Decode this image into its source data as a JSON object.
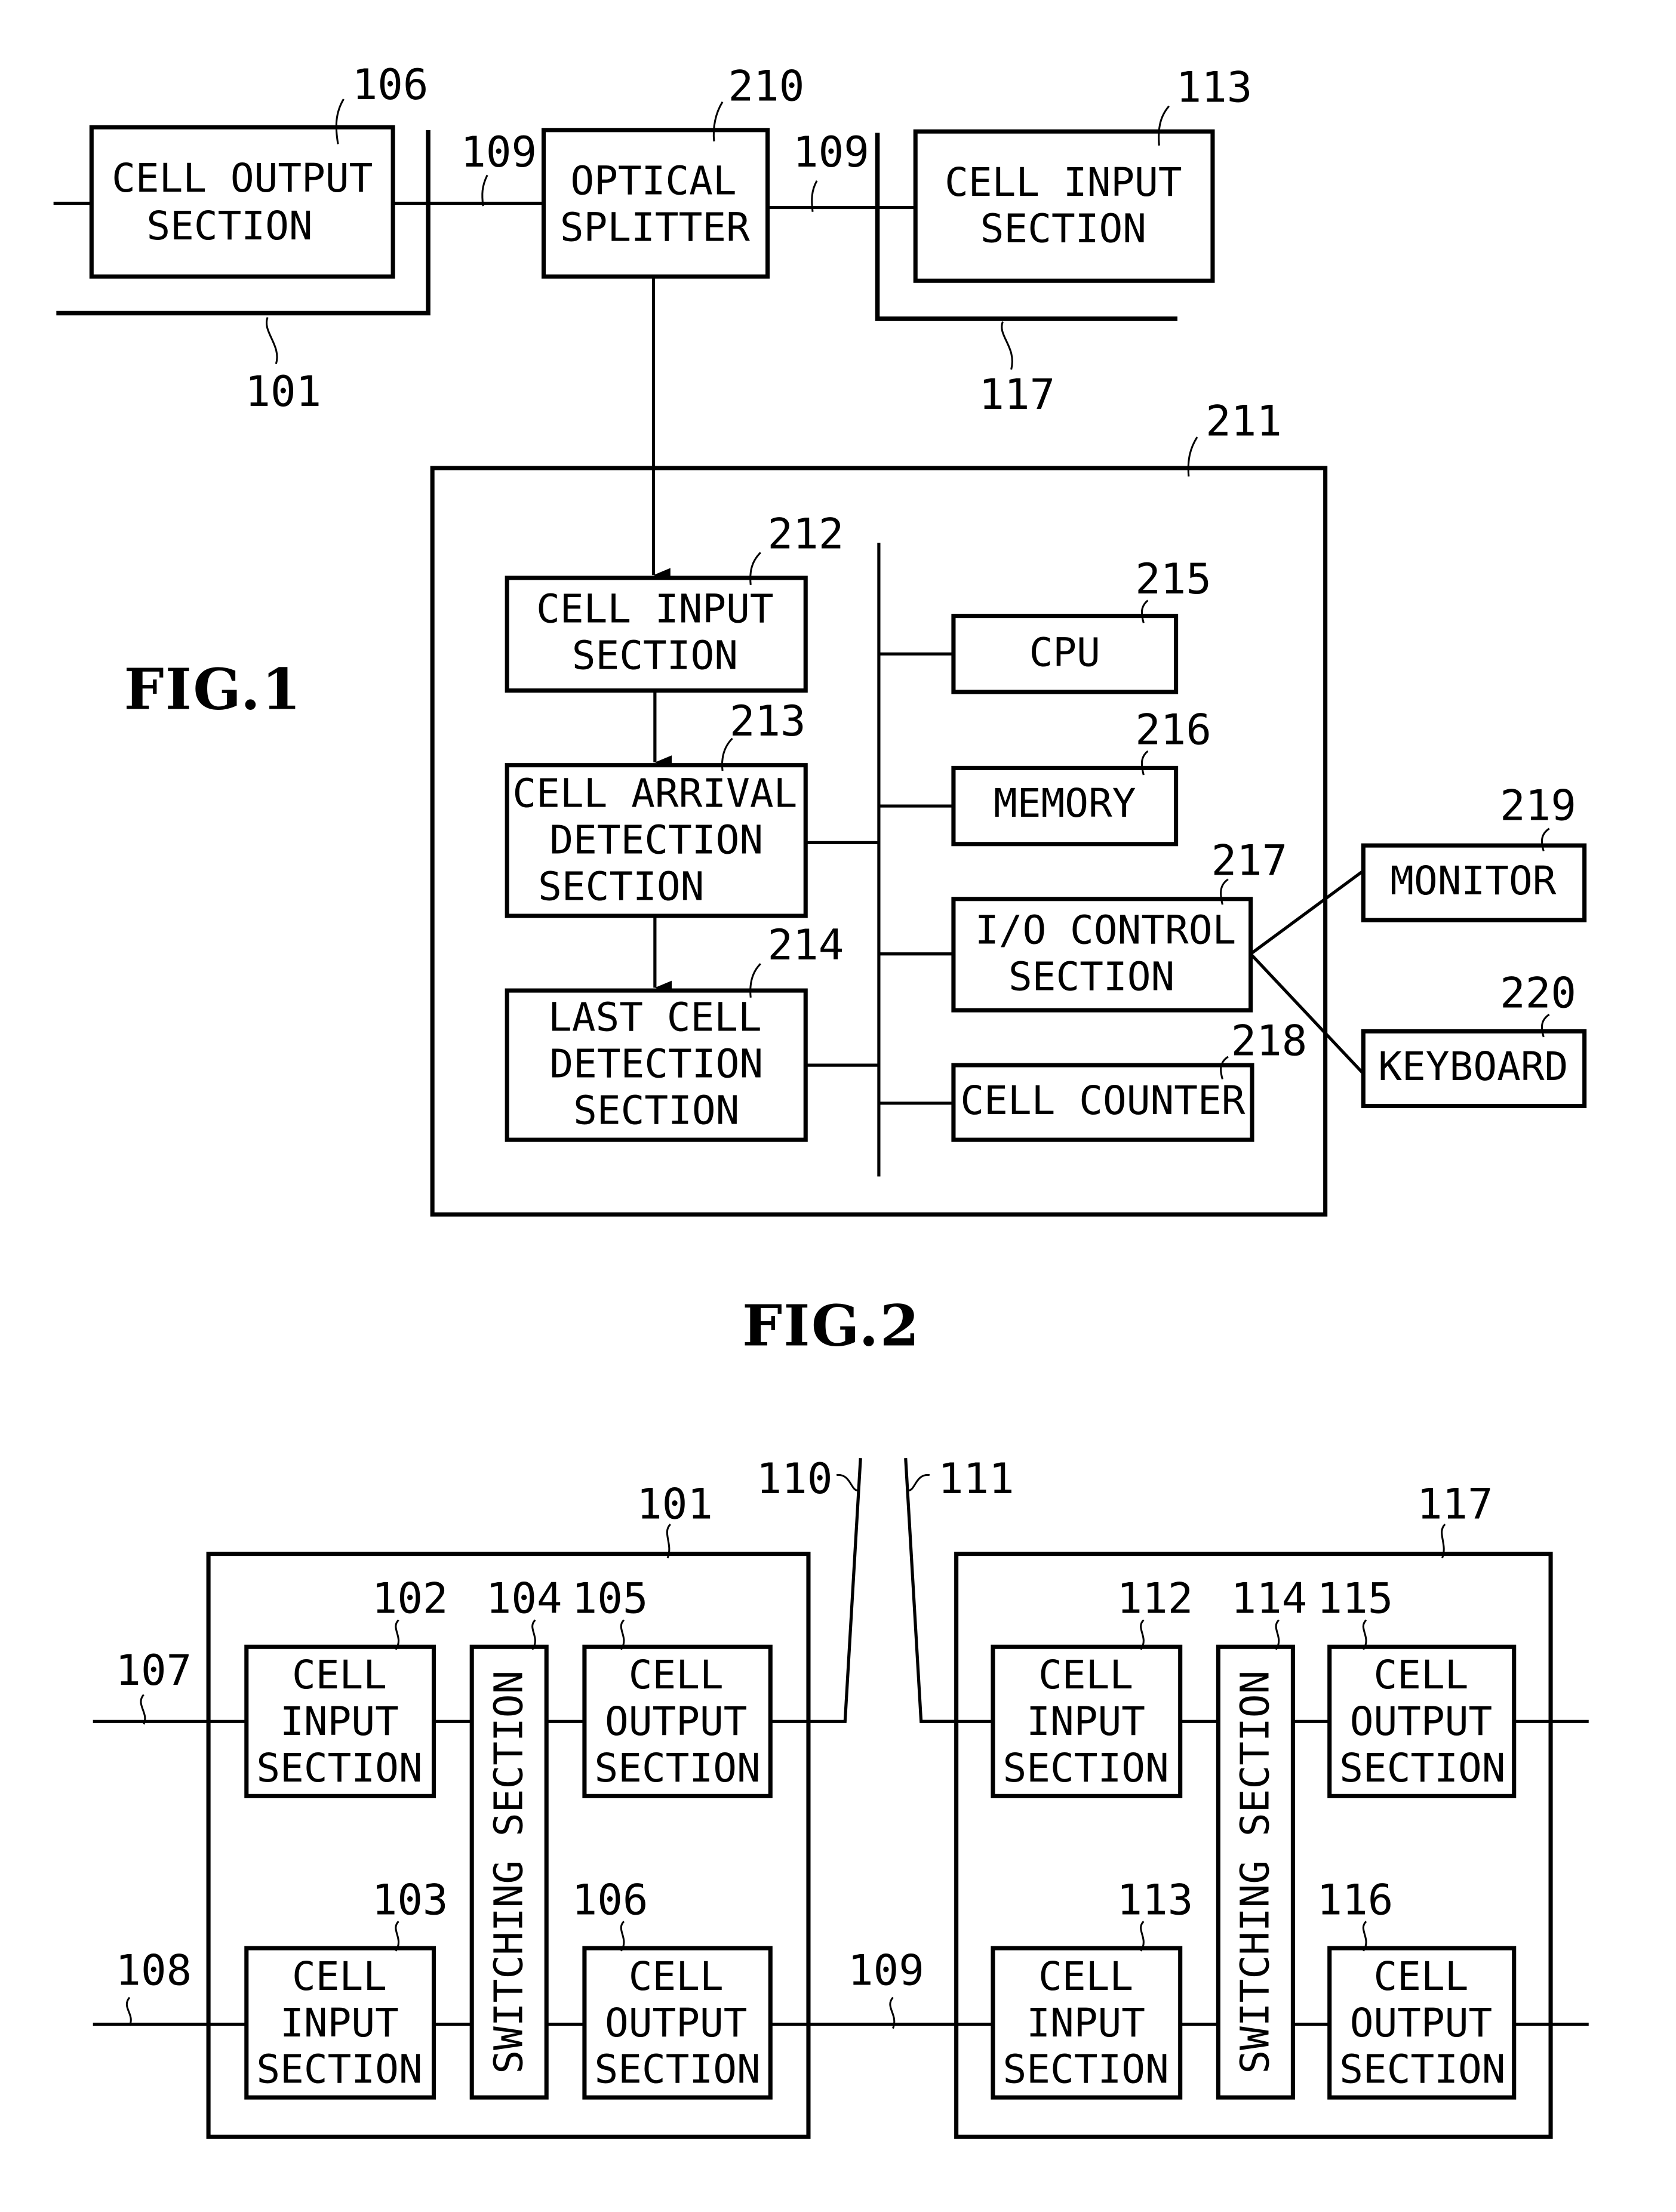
{
  "fig1": {
    "title": "FIG.1",
    "blocks": {
      "cell_output_106": {
        "ref": "106",
        "lines": [
          "CELL OUTPUT",
          "SECTION"
        ]
      },
      "optical_splitter_210": {
        "ref": "210",
        "lines": [
          "OPTICAL",
          "SPLITTER"
        ]
      },
      "cell_input_113": {
        "ref": "113",
        "lines": [
          "CELL INPUT",
          "SECTION"
        ]
      },
      "monitor_device_211": {
        "ref": "211"
      },
      "cell_input_212": {
        "ref": "212",
        "lines": [
          "CELL INPUT",
          "SECTION"
        ]
      },
      "cell_arrival_213": {
        "ref": "213",
        "lines": [
          "CELL ARRIVAL",
          "DETECTION",
          "SECTION"
        ]
      },
      "last_cell_214": {
        "ref": "214",
        "lines": [
          "LAST CELL",
          "DETECTION",
          "SECTION"
        ]
      },
      "cpu_215": {
        "ref": "215",
        "lines": [
          "CPU"
        ]
      },
      "memory_216": {
        "ref": "216",
        "lines": [
          "MEMORY"
        ]
      },
      "io_control_217": {
        "ref": "217",
        "lines": [
          "I/O CONTROL",
          "SECTION"
        ]
      },
      "cell_counter_218": {
        "ref": "218",
        "lines": [
          "CELL COUNTER"
        ]
      },
      "monitor_219": {
        "ref": "219",
        "lines": [
          "MONITOR"
        ]
      },
      "keyboard_220": {
        "ref": "220",
        "lines": [
          "KEYBOARD"
        ]
      }
    },
    "refs": {
      "line_left": "109",
      "line_right": "109",
      "node_101": "101",
      "node_117": "117"
    }
  },
  "fig2": {
    "title": "FIG.2",
    "refs": {
      "link_110": "110",
      "link_111": "111",
      "link_109": "109",
      "input_107": "107",
      "input_108": "108"
    },
    "node_101": {
      "ref": "101",
      "cell_input_102": {
        "ref": "102",
        "lines": [
          "CELL",
          "INPUT",
          "SECTION"
        ]
      },
      "cell_input_103": {
        "ref": "103",
        "lines": [
          "CELL",
          "INPUT",
          "SECTION"
        ]
      },
      "switching_104": {
        "ref": "104",
        "label": "SWITCHING SECTION"
      },
      "cell_output_105": {
        "ref": "105",
        "lines": [
          "CELL",
          "OUTPUT",
          "SECTION"
        ]
      },
      "cell_output_106": {
        "ref": "106",
        "lines": [
          "CELL",
          "OUTPUT",
          "SECTION"
        ]
      }
    },
    "node_117": {
      "ref": "117",
      "cell_input_112": {
        "ref": "112",
        "lines": [
          "CELL",
          "INPUT",
          "SECTION"
        ]
      },
      "cell_input_113": {
        "ref": "113",
        "lines": [
          "CELL",
          "INPUT",
          "SECTION"
        ]
      },
      "switching_114": {
        "ref": "114",
        "label": "SWITCHING SECTION"
      },
      "cell_output_115": {
        "ref": "115",
        "lines": [
          "CELL",
          "OUTPUT",
          "SECTION"
        ]
      },
      "cell_output_116": {
        "ref": "116",
        "lines": [
          "CELL",
          "OUTPUT",
          "SECTION"
        ]
      }
    }
  }
}
